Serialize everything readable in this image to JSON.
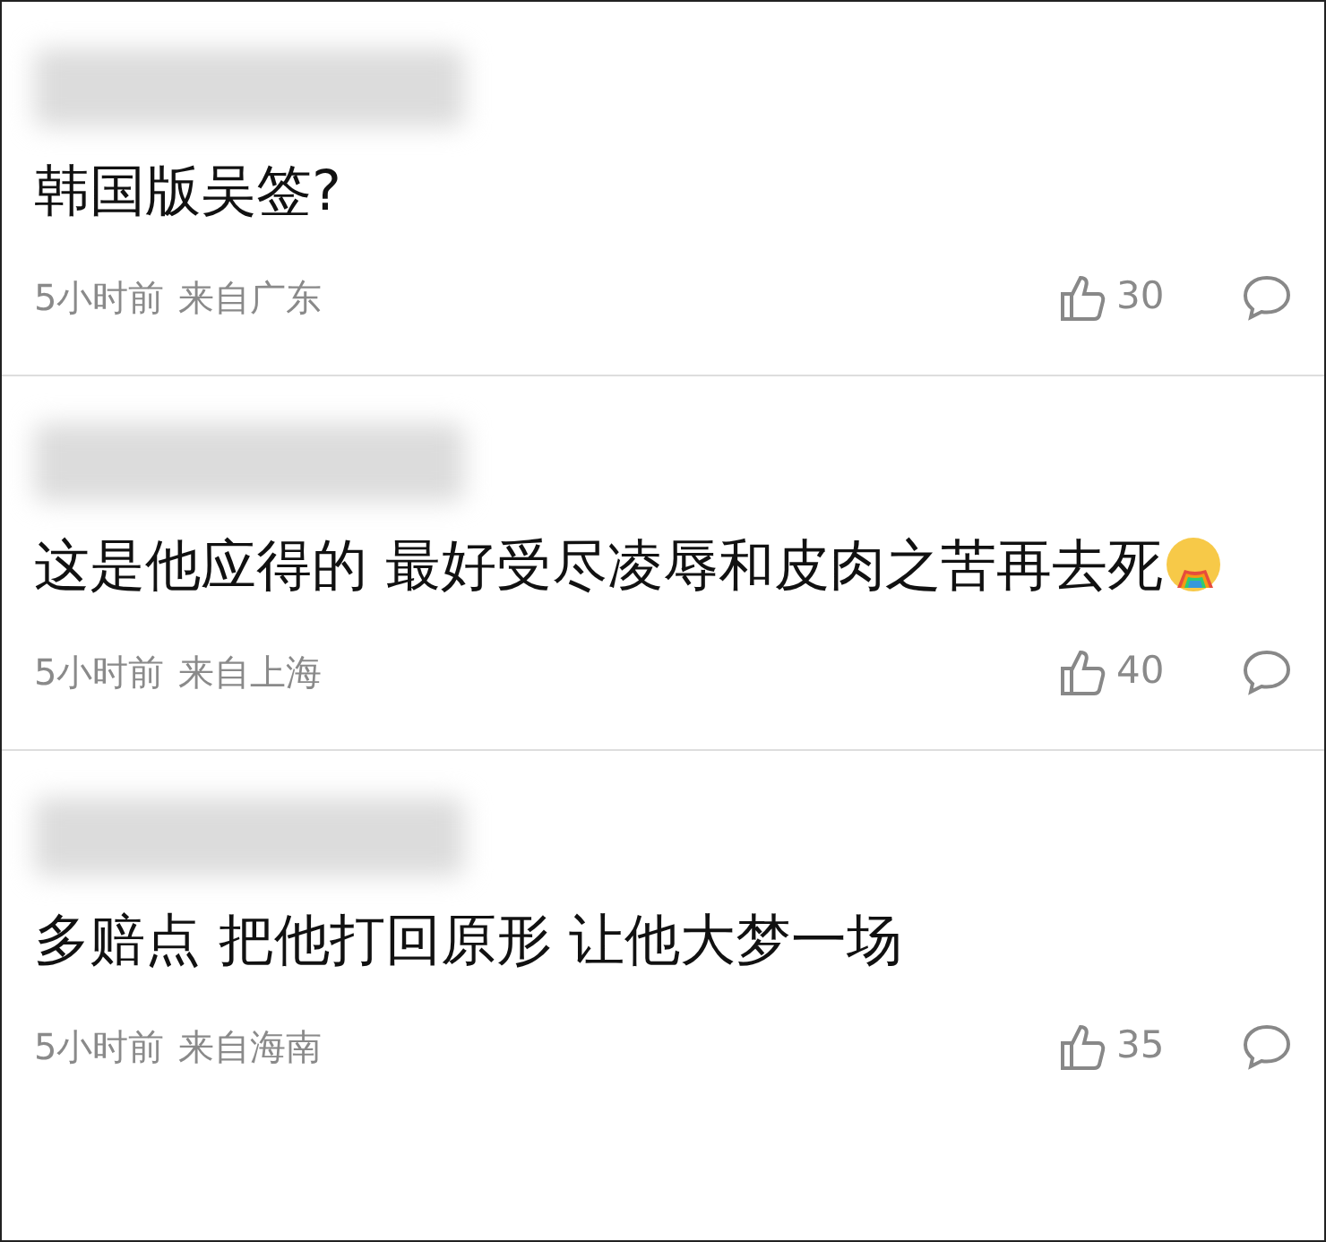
{
  "comments": [
    {
      "text": "韩国版吴签?",
      "emoji": false,
      "time": "5小时前",
      "location": "来自广东",
      "likes": "30"
    },
    {
      "text": "这是他应得的 最好受尽凌辱和皮肉之苦再去死",
      "emoji": true,
      "time": "5小时前",
      "location": "来自上海",
      "likes": "40"
    },
    {
      "text": "多赔点 把他打回原形 让他大梦一场",
      "emoji": false,
      "time": "5小时前",
      "location": "来自海南",
      "likes": "35"
    }
  ]
}
